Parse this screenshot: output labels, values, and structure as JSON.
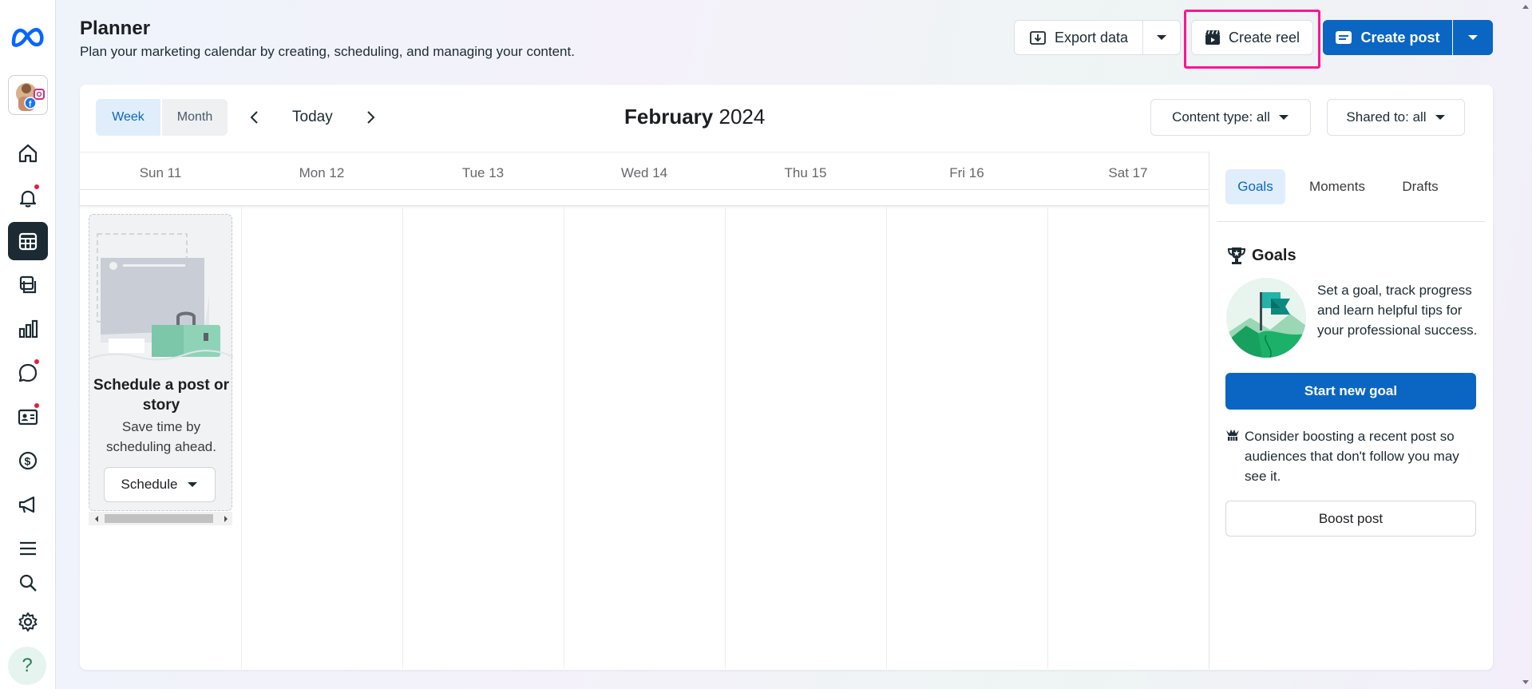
{
  "header": {
    "title": "Planner",
    "subtitle": "Plan your marketing calendar by creating, scheduling, and managing your content."
  },
  "actions": {
    "export_label": "Export data",
    "create_reel_label": "Create reel",
    "create_post_label": "Create post"
  },
  "calendar": {
    "view_week": "Week",
    "view_month": "Month",
    "today_label": "Today",
    "month_name": "February",
    "year": "2024",
    "content_filter": "Content type: all",
    "shared_filter": "Shared to: all",
    "days": [
      "Sun 11",
      "Mon 12",
      "Tue 13",
      "Wed 14",
      "Thu 15",
      "Fri 16",
      "Sat 17"
    ]
  },
  "schedule_card": {
    "title": "Schedule a post or story",
    "description": "Save time by scheduling ahead.",
    "button_label": "Schedule"
  },
  "right_panel": {
    "tabs": [
      "Goals",
      "Moments",
      "Drafts"
    ],
    "goals_heading": "Goals",
    "goals_text": "Set a goal, track progress and learn helpful tips for your professional success.",
    "start_goal_label": "Start new goal",
    "boost_tip": "Consider boosting a recent post so audiences that don't follow you may see it.",
    "boost_label": "Boost post"
  },
  "colors": {
    "accent": "#0a66c2",
    "highlight": "#ff1493",
    "sidebar_active": "#1c2b33"
  },
  "sidebar_icons": [
    "home-icon",
    "bell-icon",
    "calendar-icon",
    "content-icon",
    "insights-icon",
    "inbox-icon",
    "contact-card-icon",
    "monetization-icon",
    "ads-icon",
    "menu-icon",
    "search-icon",
    "gear-icon",
    "help-icon"
  ]
}
